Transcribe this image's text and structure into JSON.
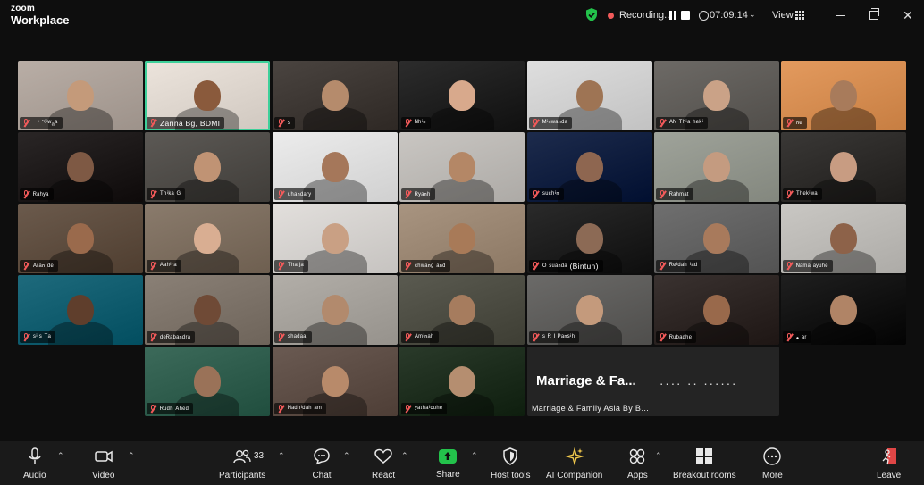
{
  "app": {
    "brand_small": "zoom",
    "brand_name": "Workplace"
  },
  "topbar": {
    "recording_label": "Recording...",
    "timer": "07:09:14",
    "view_label": "View",
    "icons": [
      "shield-check-icon",
      "record-dot-icon",
      "pause-icon",
      "stop-icon",
      "clock-icon",
      "grid-icon",
      "minimize-icon",
      "restore-icon",
      "close-icon"
    ]
  },
  "participants_grid": [
    {
      "name": "⁻⁾ ’⁽ⁱʷₐᵃ",
      "bg": "#b9aea6",
      "skin": "#c49a7a"
    },
    {
      "name": "Zarina Bg, BDMI",
      "bg": "#ece4dc",
      "skin": "#8a5a3c",
      "active": true
    },
    {
      "name": "ˢ",
      "bg": "#4a4440",
      "skin": "#b58b6c"
    },
    {
      "name": "ᴺʰⁱⁿ",
      "bg": "#2c2c2c",
      "skin": "#d8a98c"
    },
    {
      "name": "ᴹⁱⁿʷᵃⁿᵈᵃ",
      "bg": "#dedede",
      "skin": "#9e7454"
    },
    {
      "name": "ᴬᴺ ᵀʰⁱᵃ ʰᵉᵏⁱ",
      "bg": "#6d6a66",
      "skin": "#caa287"
    },
    {
      "name": "ⁿᵉ",
      "bg": "#e39a5e",
      "skin": "#a87b5b"
    },
    {
      "name": "ᴿᵃʰʸᵃ",
      "bg": "#2a2626",
      "skin": "#7e5944"
    },
    {
      "name": "ᵀʰⁱᵏᵃ ᴳ",
      "bg": "#5c5955",
      "skin": "#c09374"
    },
    {
      "name": "ᵘʰᵃⁿᵈᵃʳʸ",
      "bg": "#ececec",
      "skin": "#a5775a"
    },
    {
      "name": "ᴿʸᵃⁿʰ",
      "bg": "#c9c6c2",
      "skin": "#b48766"
    },
    {
      "name": "ˢᵘᶜʰⁱⁿ",
      "bg": "#1d2b4c",
      "skin": "#8e6650"
    },
    {
      "name": "ᴿᵃʰᵐᵃᵗ",
      "bg": "#9fa39a",
      "skin": "#c49b80"
    },
    {
      "name": "ᵀʰᵉᵏⁱʷᵃ",
      "bg": "#3a3836",
      "skin": "#c89c82"
    },
    {
      "name": "ᴬʳᵃⁿ ᵈᵉ",
      "bg": "#6b5a4c",
      "skin": "#9a6a4c"
    },
    {
      "name": "ᴬᵃʰⁱʳᵃ",
      "bg": "#8a7b6c",
      "skin": "#d9ae92"
    },
    {
      "name": "ᵀʰᵃⁱʲᵃ",
      "bg": "#e2dfdc",
      "skin": "#c9a084"
    },
    {
      "name": "ᶜʰʷᵃⁿᵍ ᵃⁿᵈ",
      "bg": "#a89480",
      "skin": "#a87a58"
    },
    {
      "name": "ᴼ ˢᵘᵃⁿᵈᵃ (Bintun)",
      "bg": "#2a2a2a",
      "skin": "#8c6a55"
    },
    {
      "name": "ᴿᵉⁱᵈᵃʰ ⁱᵃᵈ",
      "bg": "#6f6f6f",
      "skin": "#a87a5c"
    },
    {
      "name": "ᴺᵃᵐᵃ ᵃʸᵘʰᵉ",
      "bg": "#c9c7c3",
      "skin": "#8d6249"
    },
    {
      "name": "ˢⁱⁱˢ ᵀᵃ",
      "bg": "#1e6a7c",
      "skin": "#5f3e2c"
    },
    {
      "name": "ᵈᵉᴿᵃᵇᵃⁿᵈʳᵃ",
      "bg": "#8a8076",
      "skin": "#6f4a36"
    },
    {
      "name": "ˢʰᵃᵈᵃᵃⁱ",
      "bg": "#b2aea8",
      "skin": "#b28a6d"
    },
    {
      "name": "ᴬᵐⁱⁿᵃʰ",
      "bg": "#5a5a50",
      "skin": "#a67c5e"
    },
    {
      "name": "ˢ ᴿ ᴵ ᴾᵃⁿˢⁱʰ",
      "bg": "#6b6a68",
      "skin": "#c49a7c"
    },
    {
      "name": "ᴿᵘᵇᵃᵈʰᵉ",
      "bg": "#3a3230",
      "skin": "#99694b"
    },
    {
      "name": "• ᵃʳ",
      "bg": "#1f1f1f",
      "skin": "#b08466"
    },
    {
      "name": "ᴿᵘᵈʰ ᴬʰᵉᵈ",
      "bg": "#3c6a5a",
      "skin": "#9a7258"
    },
    {
      "name": "ᴺᵃᵈʰⁱᵈᵃʰ ᵃᵐ",
      "bg": "#6a5a52",
      "skin": "#b88a6a"
    },
    {
      "name": "ʸᵃᵗʰᵃⁱᶜᵘʰᵉ",
      "bg": "#2a3a2a",
      "skin": "#b58e70"
    }
  ],
  "banner_tile": {
    "display_text": "Marriage  &  Fa...",
    "display_tail": "․․․․ ․․ ․․․․․․",
    "name": "Marriage & Family Asia By B...  ᵏᵃᵇⁱᵃⁱᵏᵉʳ"
  },
  "toolbar": {
    "audio": "Audio",
    "video": "Video",
    "participants": "Participants",
    "participants_count": "33",
    "chat": "Chat",
    "react": "React",
    "share": "Share",
    "host_tools": "Host tools",
    "ai_companion": "AI Companion",
    "apps": "Apps",
    "breakout_rooms": "Breakout rooms",
    "more": "More",
    "leave": "Leave"
  },
  "colors": {
    "accent_green": "#23c24b",
    "active_speaker": "#3ed09a",
    "mute_red": "#f25a5a",
    "leave_red": "#e04646"
  }
}
